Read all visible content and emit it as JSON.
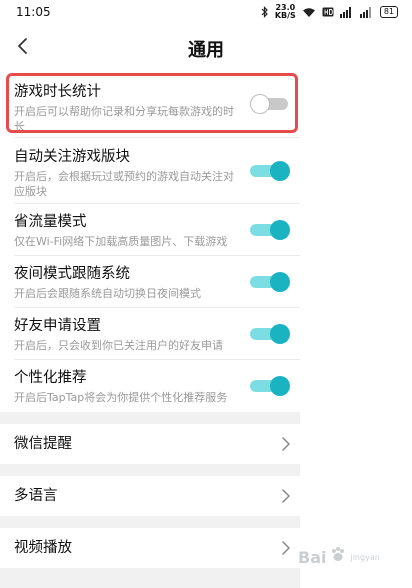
{
  "status_bar": {
    "time": "11:05",
    "speed_value": "23.0",
    "speed_unit": "KB/S",
    "battery": "81",
    "icons": [
      "bluetooth-icon",
      "speed-icon",
      "wifi-icon",
      "hd-icon",
      "signal-icon",
      "signal2-icon",
      "battery-icon"
    ]
  },
  "nav": {
    "back_icon": "chevron-left-icon",
    "title": "通用"
  },
  "settings": [
    {
      "title": "游戏时长统计",
      "desc": "开启后可以帮助你记录和分享玩每款游戏的时长",
      "enabled": false,
      "highlighted": true
    },
    {
      "title": "自动关注游戏版块",
      "desc": "开启后，会根据玩过或预约的游戏自动关注对应版块",
      "enabled": true
    },
    {
      "title": "省流量模式",
      "desc": "仅在Wi-Fi网络下加载高质量图片、下载游戏",
      "enabled": true
    },
    {
      "title": "夜间模式跟随系统",
      "desc": "开启后会跟随系统自动切换日夜间模式",
      "enabled": true
    },
    {
      "title": "好友申请设置",
      "desc": "开启后，只会收到你已关注用户的好友申请",
      "enabled": true
    },
    {
      "title": "个性化推荐",
      "desc": "开启后TapTap将会为你提供个性化推荐服务",
      "enabled": true
    }
  ],
  "links": [
    {
      "label": "微信提醒"
    },
    {
      "label": "多语言"
    },
    {
      "label": "视频播放"
    }
  ],
  "colors": {
    "toggle_on_track": "#7cdde2",
    "toggle_on_knob": "#19b3c2",
    "toggle_off_track": "#c9c9c9",
    "highlight": "#e74c4c",
    "section_gap": "#f1f1f1"
  },
  "watermark": {
    "main": "Bai",
    "sub": "jingyan"
  }
}
